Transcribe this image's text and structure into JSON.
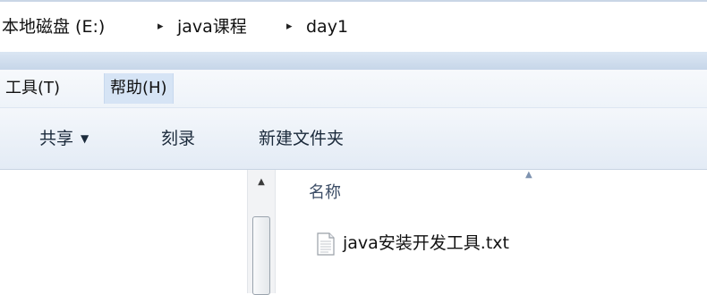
{
  "address_bar": {
    "drive": "本地磁盘 (E:)",
    "folder1": "java课程",
    "folder2": "day1",
    "separator": "▸"
  },
  "menu": {
    "tools": "工具(T)",
    "help": "帮助(H)"
  },
  "toolbar": {
    "share": "共享",
    "share_arrow": "▼",
    "burn": "刻录",
    "new_folder": "新建文件夹"
  },
  "file_list": {
    "column_name": "名称",
    "files": [
      {
        "name": "java安装开发工具.txt",
        "icon": "text-file-icon"
      }
    ]
  },
  "colors": {
    "menu_active_bg": "#d6e4f5",
    "toolbar_text": "#1b2a3b",
    "header_text": "#3c4d66"
  }
}
